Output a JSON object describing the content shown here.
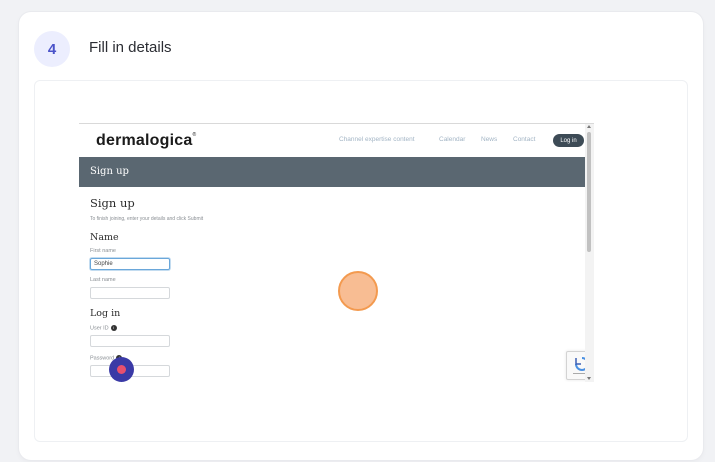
{
  "step": {
    "number": "4",
    "title": "Fill in details"
  },
  "site": {
    "logo": "dermalogica",
    "nav": [
      "Channel expertise content",
      "Calendar",
      "News",
      "Contact"
    ],
    "login_button": "Log in",
    "banner_title": "Sign up",
    "form_title": "Sign up",
    "form_subtitle": "To finish joining, enter your details and click Submit",
    "section_name": "Name",
    "first_name_label": "First name",
    "first_name_value": "Sophie",
    "last_name_label": "Last name",
    "last_name_value": "",
    "section_login": "Log in",
    "user_id_label": "User ID",
    "password_label": "Password"
  },
  "icons": {
    "recaptcha": "recaptcha-icon",
    "info": "info-icon"
  },
  "colors": {
    "step_badge_bg": "#eceefe",
    "step_badge_text": "#4b53c9",
    "banner": "#5a6771",
    "click_marker": "#f39a4f",
    "record": "#3a3aa6"
  }
}
